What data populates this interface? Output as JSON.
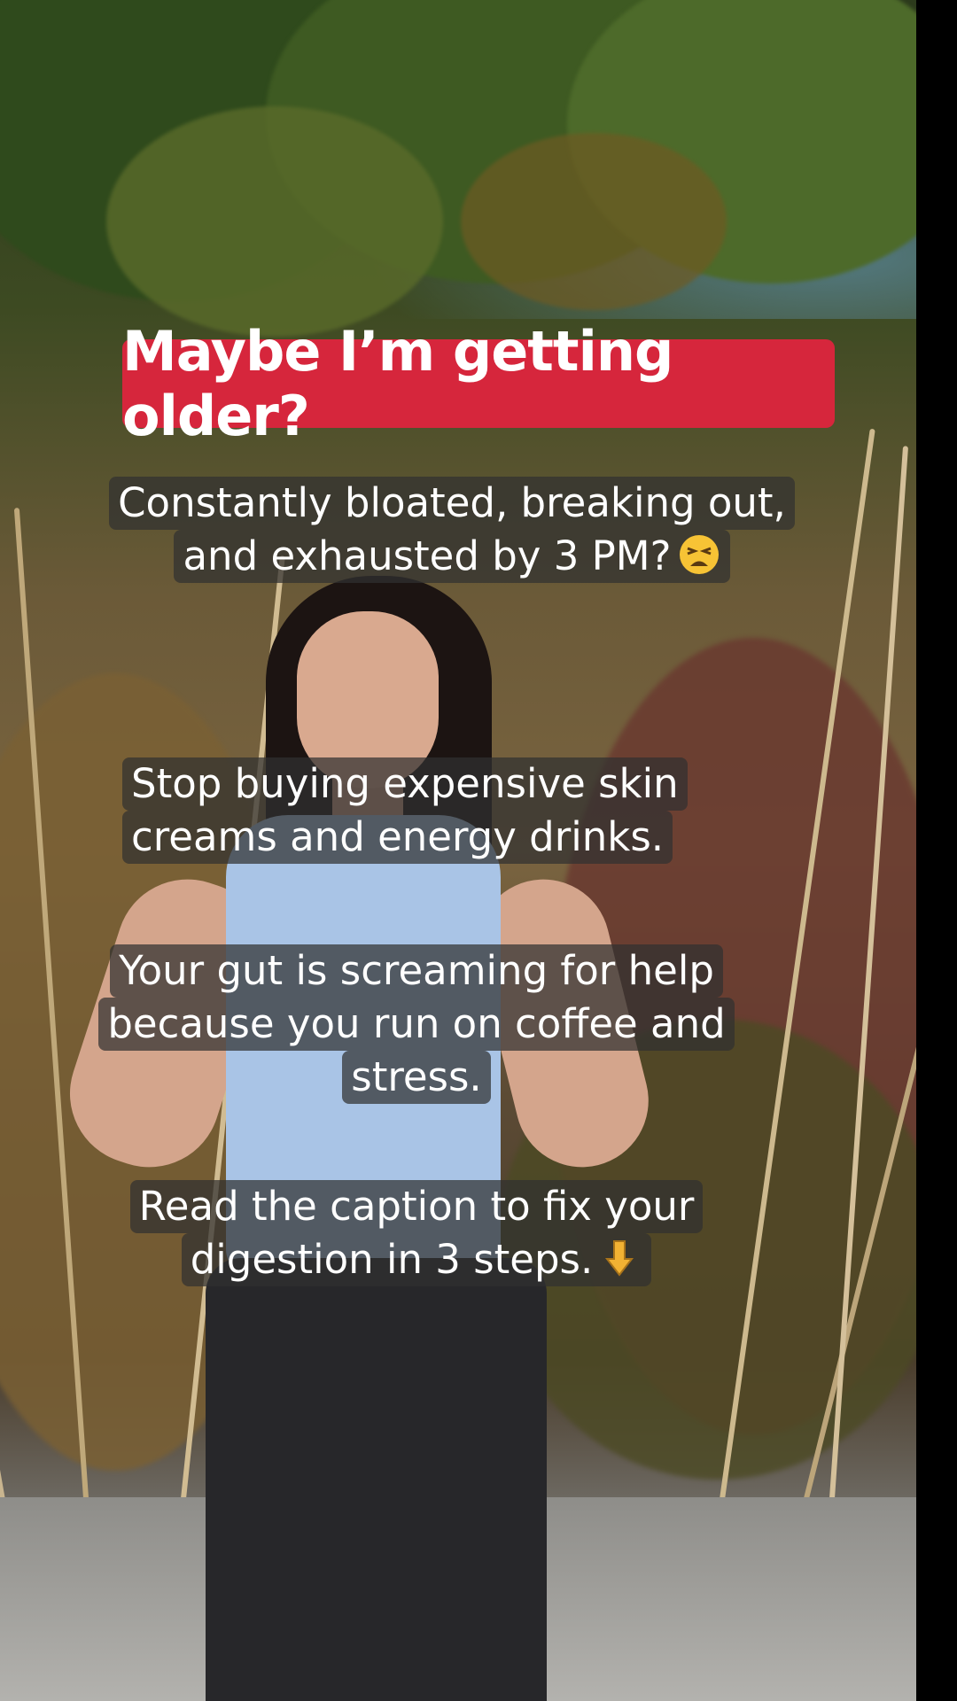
{
  "video": {
    "title_banner": "Maybe I’m getting older?",
    "captions": [
      {
        "lines": [
          "Constantly bloated, breaking out,",
          "and exhausted by 3 PM?"
        ],
        "emoji": "tired-face-emoji"
      },
      {
        "lines": [
          "Stop buying expensive skin",
          "creams and energy drinks."
        ]
      },
      {
        "lines": [
          "Your gut is screaming for help",
          "because you run on coffee and",
          "stress."
        ]
      },
      {
        "lines": [
          "Read the caption to fix your",
          "digestion in 3 steps."
        ],
        "emoji": "pointing-down-emoji"
      }
    ]
  },
  "colors": {
    "banner_red": "#d6263c",
    "caption_bg": "rgba(48,48,48,0.72)",
    "caption_text": "#ffffff"
  }
}
